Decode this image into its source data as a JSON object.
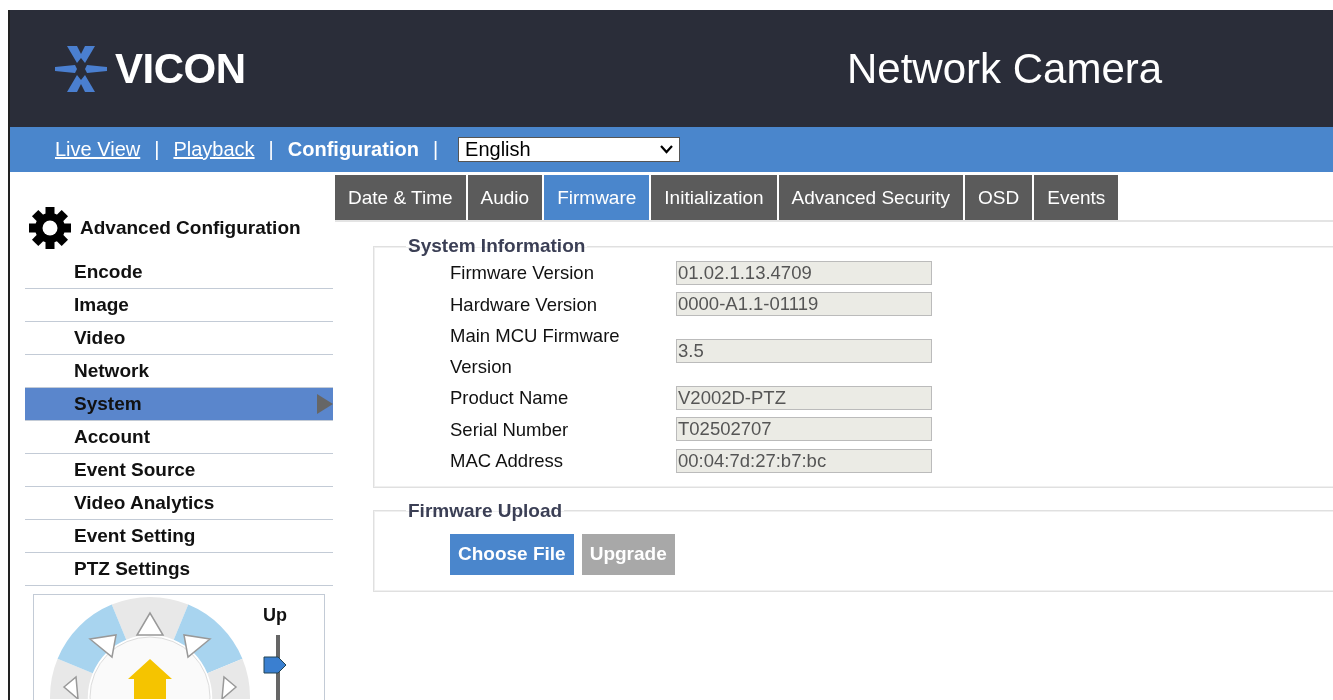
{
  "header": {
    "logo": "VICON",
    "title": "Network Camera"
  },
  "nav": {
    "items": [
      {
        "kind": "link",
        "label": "Live View",
        "selected": false
      },
      {
        "kind": "separator",
        "label": "|"
      },
      {
        "kind": "link",
        "label": "Playback",
        "selected": false
      },
      {
        "kind": "separator",
        "label": "|"
      },
      {
        "kind": "link",
        "label": "Configuration",
        "selected": true
      },
      {
        "kind": "separator",
        "label": "|"
      }
    ],
    "language": {
      "value": "English"
    }
  },
  "sidebar": {
    "heading": "Advanced Configuration",
    "items": [
      {
        "label": "Encode",
        "selected": false
      },
      {
        "label": "Image",
        "selected": false
      },
      {
        "label": "Video",
        "selected": false
      },
      {
        "label": "Network",
        "selected": false
      },
      {
        "label": "System",
        "selected": true
      },
      {
        "label": "Account",
        "selected": false
      },
      {
        "label": "Event Source",
        "selected": false
      },
      {
        "label": "Video Analytics",
        "selected": false
      },
      {
        "label": "Event Setting",
        "selected": false
      },
      {
        "label": "PTZ Settings",
        "selected": false
      }
    ],
    "ptz": {
      "slider_label": "Up",
      "slider": {
        "level": 0.75
      }
    }
  },
  "tabs": [
    {
      "label": "Date & Time",
      "selected": false
    },
    {
      "label": "Audio",
      "selected": false
    },
    {
      "label": "Firmware",
      "selected": true
    },
    {
      "label": "Initialization",
      "selected": false
    },
    {
      "label": "Advanced Security",
      "selected": false
    },
    {
      "label": "OSD",
      "selected": false
    },
    {
      "label": "Events",
      "selected": false
    }
  ],
  "system_information": {
    "legend": "System Information",
    "fields": [
      {
        "label": "Firmware Version",
        "value": "01.02.1.13.4709"
      },
      {
        "label": "Hardware Version",
        "value": "0000-A1.1-01119"
      },
      {
        "label": "Main MCU Firmware Version",
        "value": "3.5"
      },
      {
        "label": "Product Name",
        "value": "V2002D-PTZ"
      },
      {
        "label": "Serial Number",
        "value": "T02502707"
      },
      {
        "label": "MAC Address",
        "value": "00:04:7d:27:b7:bc"
      }
    ]
  },
  "firmware_upload": {
    "legend": "Firmware Upload",
    "buttons": [
      {
        "label": "Choose File",
        "disabled": false
      },
      {
        "label": "Upgrade",
        "disabled": true
      }
    ]
  }
}
